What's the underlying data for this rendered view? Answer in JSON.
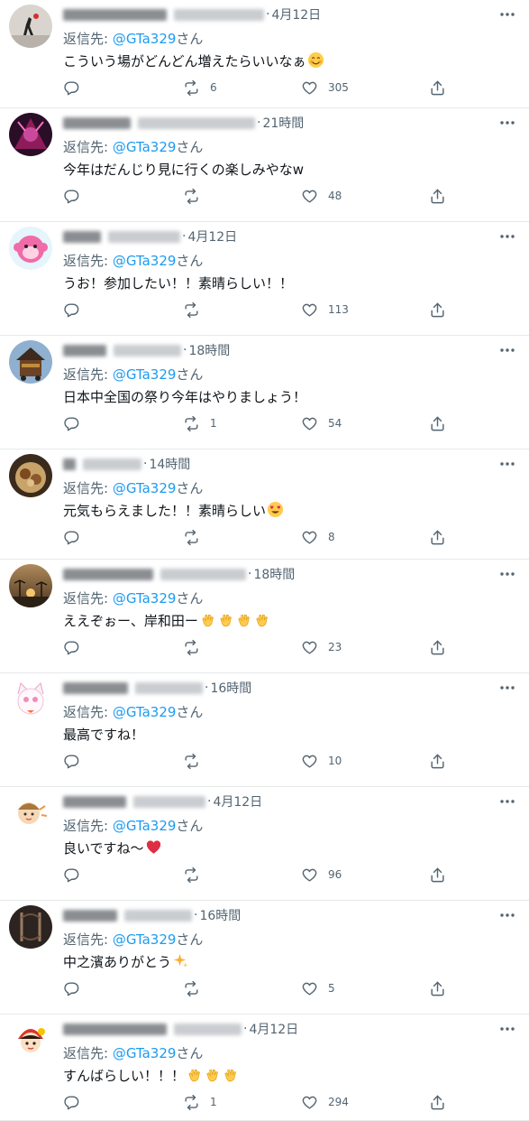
{
  "common": {
    "reply_prefix": "返信先: ",
    "reply_suffix": "さん"
  },
  "colors": {
    "link": "#1d9bf0",
    "muted": "#536471",
    "text": "#0f1419",
    "divider": "#e7e9ea"
  },
  "tweets": [
    {
      "time": "4月12日",
      "mention": "@GTa329",
      "text": "こういう場がどんどん増えたらいいなぁ",
      "emojis": [
        "smiling-blush"
      ],
      "retweets": "6",
      "likes": "305",
      "avatar": "street-art"
    },
    {
      "time": "21時間",
      "mention": "@GTa329",
      "text": "今年はだんじり見に行くの楽しみやなw",
      "emojis": [],
      "retweets": "",
      "likes": "48",
      "avatar": "dark-art"
    },
    {
      "time": "4月12日",
      "mention": "@GTa329",
      "text": "うお！参加したい！！素晴らしい！！",
      "emojis": [],
      "retweets": "",
      "likes": "113",
      "avatar": "pink-monkey"
    },
    {
      "time": "18時間",
      "mention": "@GTa329",
      "text": "日本中全国の祭り今年はやりましょう！",
      "emojis": [],
      "retweets": "1",
      "likes": "54",
      "avatar": "danjiri-float"
    },
    {
      "time": "14時間",
      "mention": "@GTa329",
      "text": "元気もらえました！！素晴らしい",
      "emojis": [
        "heart-eyes"
      ],
      "retweets": "",
      "likes": "8",
      "avatar": "food-plate"
    },
    {
      "time": "18時間",
      "mention": "@GTa329",
      "text": "ええぞぉー、岸和田ー",
      "emojis": [
        "clap",
        "clap",
        "clap",
        "clap"
      ],
      "retweets": "",
      "likes": "23",
      "avatar": "sunset-palm"
    },
    {
      "time": "16時間",
      "mention": "@GTa329",
      "text": "最高ですね！",
      "emojis": [],
      "retweets": "",
      "likes": "10",
      "avatar": "white-cat"
    },
    {
      "time": "4月12日",
      "mention": "@GTa329",
      "text": "良いですね〜",
      "emojis": [
        "red-heart"
      ],
      "retweets": "",
      "likes": "96",
      "avatar": "cartoon-kid"
    },
    {
      "time": "16時間",
      "mention": "@GTa329",
      "text": "中之濱ありがとう",
      "emojis": [
        "sparkles"
      ],
      "retweets": "",
      "likes": "5",
      "avatar": "dark-emblem"
    },
    {
      "time": "4月12日",
      "mention": "@GTa329",
      "text": "すんばらしい！！！",
      "emojis": [
        "clap",
        "clap",
        "clap"
      ],
      "retweets": "1",
      "likes": "294",
      "avatar": "cartoon-girl"
    }
  ]
}
